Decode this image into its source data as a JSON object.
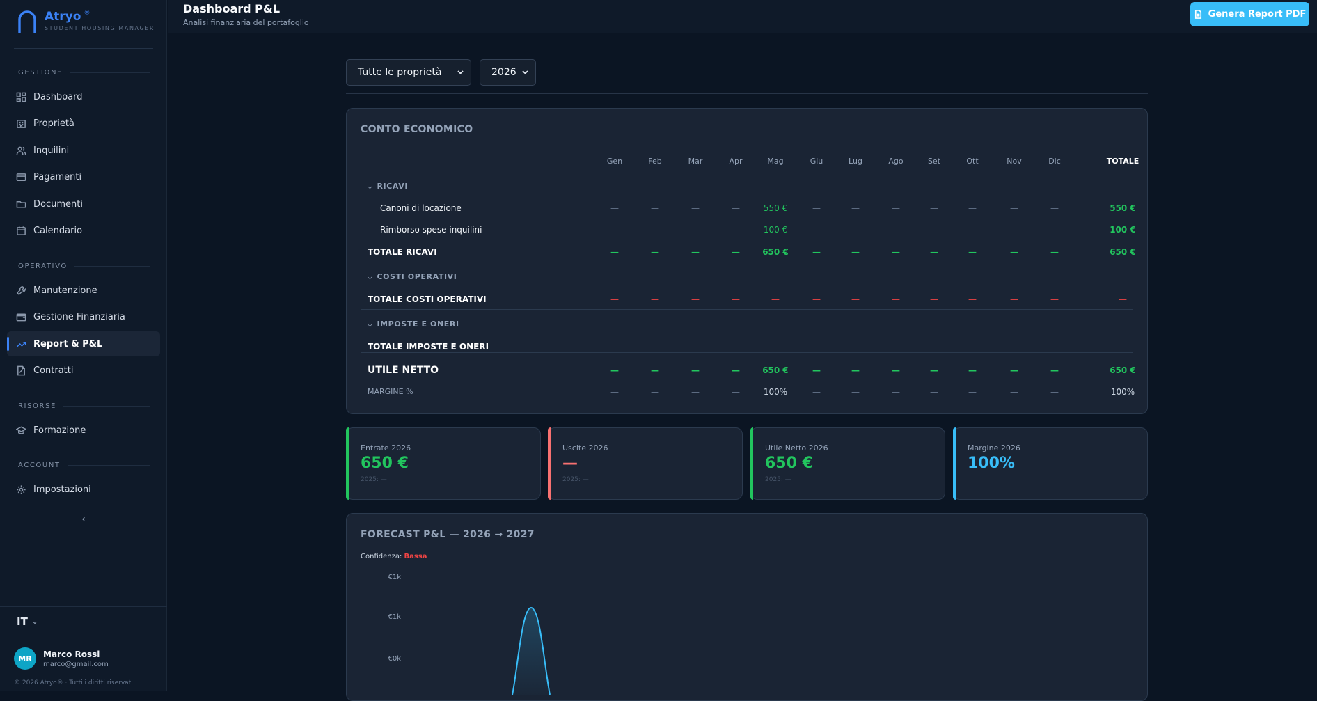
{
  "brand": {
    "name": "Atryo",
    "reg": "®",
    "tagline": "STUDENT HOUSING MANAGER"
  },
  "sidebar": {
    "sections": [
      {
        "title": "GESTIONE"
      },
      {
        "title": "OPERATIVO"
      },
      {
        "title": "RISORSE"
      },
      {
        "title": "ACCOUNT"
      }
    ],
    "items": [
      {
        "label": "Dashboard",
        "icon": "grid-icon"
      },
      {
        "label": "Proprietà",
        "icon": "building-icon"
      },
      {
        "label": "Inquilini",
        "icon": "users-icon"
      },
      {
        "label": "Pagamenti",
        "icon": "card-icon"
      },
      {
        "label": "Documenti",
        "icon": "folder-icon"
      },
      {
        "label": "Calendario",
        "icon": "calendar-icon"
      },
      {
        "label": "Manutenzione",
        "icon": "wrench-icon"
      },
      {
        "label": "Gestione Finanziaria",
        "icon": "wallet-icon"
      },
      {
        "label": "Report & P&L",
        "icon": "trend-icon",
        "active": true
      },
      {
        "label": "Contratti",
        "icon": "contract-icon"
      },
      {
        "label": "Formazione",
        "icon": "graduation-icon"
      },
      {
        "label": "Impostazioni",
        "icon": "gear-icon"
      }
    ],
    "collapse_icon": "chevron-left-icon",
    "language": "IT",
    "user": {
      "initials": "MR",
      "name": "Marco Rossi",
      "email": "marco@gmail.com"
    },
    "copyright": "© 2026 Atryo® · Tutti i diritti riservati"
  },
  "header": {
    "title": "Dashboard P&L",
    "subtitle": "Analisi finanziaria del portafoglio",
    "generate_button": "Genera Report PDF"
  },
  "filters": {
    "property": "Tutte le proprietà",
    "year": "2026"
  },
  "pl": {
    "title": "CONTO ECONOMICO",
    "months": [
      "Gen",
      "Feb",
      "Mar",
      "Apr",
      "Mag",
      "Giu",
      "Lug",
      "Ago",
      "Set",
      "Ott",
      "Nov",
      "Dic"
    ],
    "total_header": "TOTALE",
    "sections": {
      "ricavi": "RICAVI",
      "costi": "COSTI OPERATIVI",
      "imposte": "IMPOSTE E ONERI"
    },
    "rows": {
      "canoni": {
        "label": "Canoni di locazione",
        "values": [
          "—",
          "—",
          "—",
          "—",
          "550 €",
          "—",
          "—",
          "—",
          "—",
          "—",
          "—",
          "—"
        ],
        "total": "550 €"
      },
      "rimborso": {
        "label": "Rimborso spese inquilini",
        "values": [
          "—",
          "—",
          "—",
          "—",
          "100 €",
          "—",
          "—",
          "—",
          "—",
          "—",
          "—",
          "—"
        ],
        "total": "100 €"
      },
      "tot_ricavi": {
        "label": "TOTALE RICAVI",
        "values": [
          "—",
          "—",
          "—",
          "—",
          "650 €",
          "—",
          "—",
          "—",
          "—",
          "—",
          "—",
          "—"
        ],
        "total": "650 €"
      },
      "tot_costi": {
        "label": "TOTALE COSTI OPERATIVI",
        "values": [
          "—",
          "—",
          "—",
          "—",
          "—",
          "—",
          "—",
          "—",
          "—",
          "—",
          "—",
          "—"
        ],
        "total": "—"
      },
      "tot_imposte": {
        "label": "TOTALE IMPOSTE E ONERI",
        "values": [
          "—",
          "—",
          "—",
          "—",
          "—",
          "—",
          "—",
          "—",
          "—",
          "—",
          "—",
          "—"
        ],
        "total": "—"
      },
      "utile": {
        "label": "UTILE NETTO",
        "values": [
          "—",
          "—",
          "—",
          "—",
          "650 €",
          "—",
          "—",
          "—",
          "—",
          "—",
          "—",
          "—"
        ],
        "total": "650 €"
      },
      "margine": {
        "label": "MARGINE %",
        "values": [
          "—",
          "—",
          "—",
          "—",
          "100%",
          "—",
          "—",
          "—",
          "—",
          "—",
          "—",
          "—"
        ],
        "total": "100%"
      }
    }
  },
  "kpis": [
    {
      "label": "Entrate 2026",
      "value": "650 €",
      "compare": "2025: —",
      "color": "#22c55e"
    },
    {
      "label": "Uscite 2026",
      "value": "—",
      "compare": "2025: —",
      "color": "#f87171"
    },
    {
      "label": "Utile Netto 2026",
      "value": "650 €",
      "compare": "2025: —",
      "color": "#22c55e"
    },
    {
      "label": "Margine 2026",
      "value": "100%",
      "compare": "",
      "color": "#38bdf8"
    }
  ],
  "forecast": {
    "title": "FORECAST P&L — 2026 → 2027",
    "confidence_label": "Confidenza:",
    "confidence_value": "Bassa",
    "y_ticks": [
      "€1k",
      "€1k",
      "€0k"
    ]
  },
  "colors": {
    "accent": "#3b82f6",
    "cyan": "#38bdf8",
    "green": "#22c55e",
    "red": "#ef4444"
  }
}
